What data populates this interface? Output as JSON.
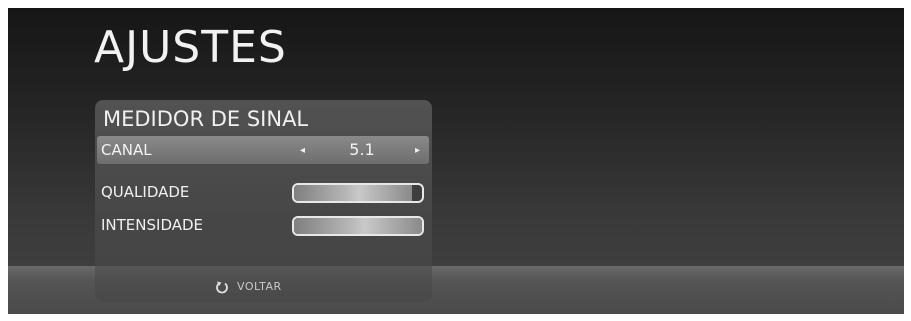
{
  "title": "AJUSTES",
  "panel": {
    "title": "MEDIDOR DE SINAL",
    "canal": {
      "label": "CANAL",
      "value": "5.1",
      "left_arrow": "◂",
      "right_arrow": "▸"
    },
    "meters": [
      {
        "label": "QUALIDADE",
        "level": 0.92
      },
      {
        "label": "INTENSIDADE",
        "level": 1.0
      }
    ],
    "back": {
      "label": "VOLTAR",
      "icon": "back-arrow-icon"
    }
  }
}
